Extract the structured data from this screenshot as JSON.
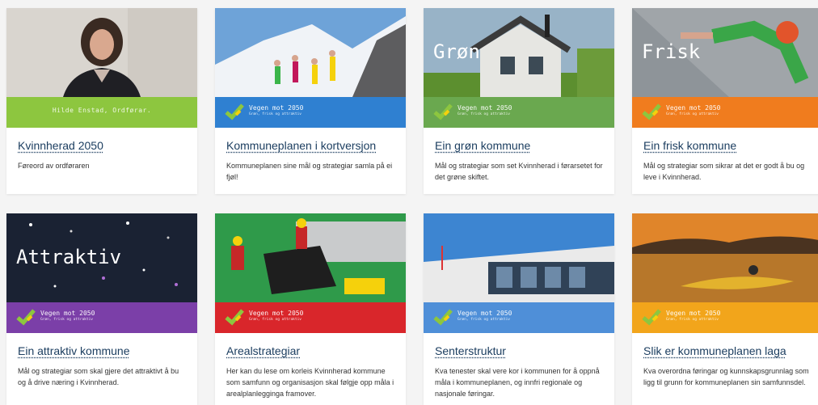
{
  "cards": [
    {
      "title": "Kvinnherad 2050",
      "desc": "Føreord av ordføraren",
      "band_caption": "Hilde Enstad, Ordførar.",
      "band_color": "#8dc63f"
    },
    {
      "title": "Kommuneplanen i kortversjon",
      "desc": "Kommuneplanen sine mål og strategiar samla på ei fjøl!",
      "badge_main": "Vegen mot 2050",
      "badge_sub": "Grøn, frisk og attraktiv",
      "band_color": "#2f80d1"
    },
    {
      "title": "Ein grøn kommune",
      "desc": "Mål og strategiar som set Kvinnherad i førarsetet for det grøne skiftet.",
      "overlay_word": "Grøn",
      "badge_main": "Vegen mot 2050",
      "badge_sub": "Grøn, frisk og attraktiv",
      "band_color": "#6aa84f"
    },
    {
      "title": "Ein frisk kommune",
      "desc": "Mål og strategiar som sikrar at det er godt å bu og leve i Kvinnherad.",
      "overlay_word": "Frisk",
      "badge_main": "Vegen mot 2050",
      "badge_sub": "Grøn, frisk og attraktiv",
      "band_color": "#f07c1e"
    },
    {
      "title": "Ein attraktiv kommune",
      "desc": "Mål og strategiar som skal gjere det attraktivt å bu og å drive næring i Kvinnherad.",
      "overlay_word": "Attraktiv",
      "badge_main": "Vegen mot 2050",
      "badge_sub": "Grøn, frisk og attraktiv",
      "band_color": "#7b3fa8"
    },
    {
      "title": "Arealstrategiar",
      "desc": "Her kan du lese om korleis Kvinnherad kommune som samfunn og organisasjon skal følgje opp måla i arealplanlegginga framover.",
      "badge_main": "Vegen mot 2050",
      "badge_sub": "Grøn, frisk og attraktiv",
      "band_color": "#d9262b"
    },
    {
      "title": "Senterstruktur",
      "desc": "Kva tenester skal vere kor i kommunen for å oppnå måla i kommuneplanen, og innfri regionale og nasjonale føringar.",
      "badge_main": "Vegen mot 2050",
      "badge_sub": "Grøn, frisk og attraktiv",
      "band_color": "#4f8fd8"
    },
    {
      "title": "Slik er kommuneplanen laga",
      "desc": "Kva overordna føringar og kunnskapsgrunnlag som ligg til grunn for kommuneplanen sin samfunnsdel.",
      "badge_main": "Vegen mot 2050",
      "badge_sub": "Grøn, frisk og attraktiv",
      "band_color": "#f2a51b"
    }
  ],
  "colors": {
    "title_link": "#1c3e60",
    "badge_green": "#8dc63f",
    "badge_yellow": "#f5d10c"
  }
}
